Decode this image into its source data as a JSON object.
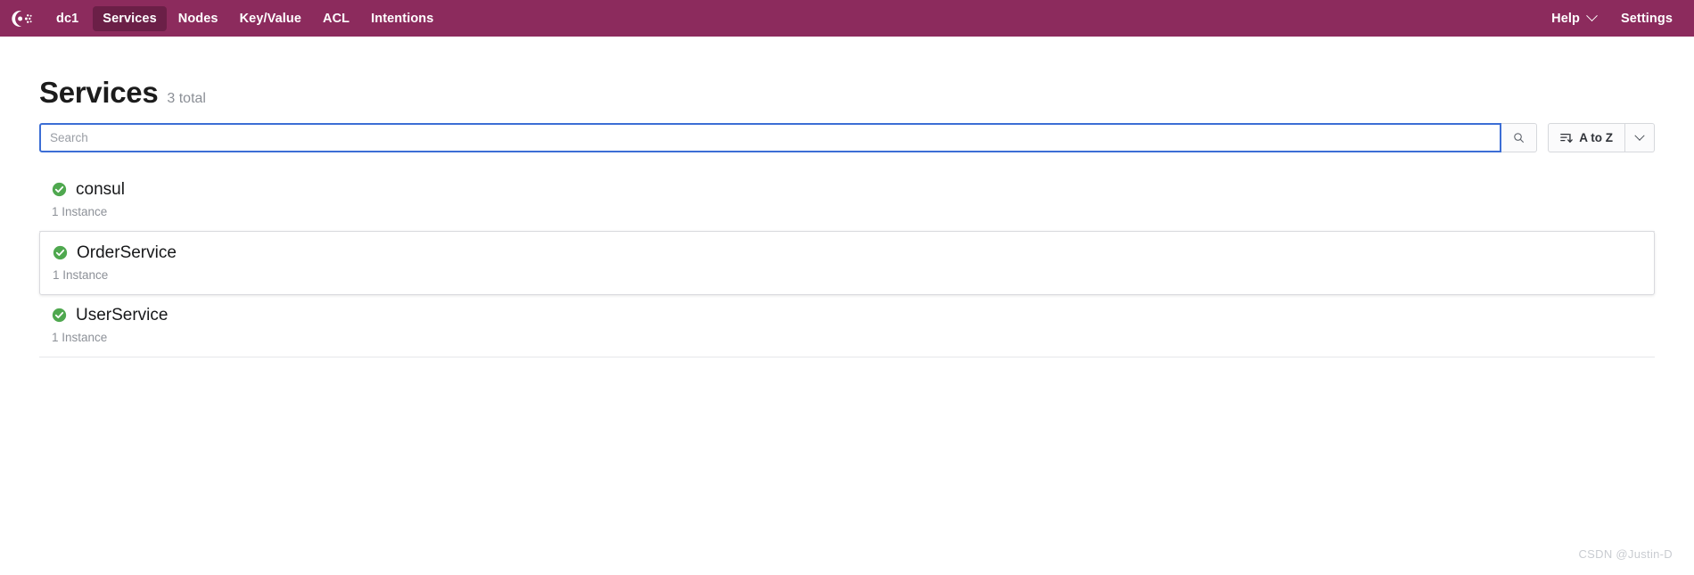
{
  "nav": {
    "logo_icon": "consul-logo-icon",
    "datacenter": "dc1",
    "items": [
      {
        "label": "Services",
        "active": true
      },
      {
        "label": "Nodes",
        "active": false
      },
      {
        "label": "Key/Value",
        "active": false
      },
      {
        "label": "ACL",
        "active": false
      },
      {
        "label": "Intentions",
        "active": false
      }
    ],
    "help_label": "Help",
    "help_icon": "chevron-down-icon",
    "settings_label": "Settings"
  },
  "header": {
    "title": "Services",
    "count_label": "3 total"
  },
  "toolbar": {
    "search_value": "",
    "search_placeholder": "Search",
    "search_icon": "search-icon",
    "sort_label": "A to Z",
    "sort_icon": "sort-descending-icon",
    "sort_caret_icon": "chevron-down-icon"
  },
  "services": [
    {
      "name": "consul",
      "instances": "1 Instance",
      "status": "passing",
      "status_icon": "check-circle-icon",
      "hovered": false
    },
    {
      "name": "OrderService",
      "instances": "1 Instance",
      "status": "passing",
      "status_icon": "check-circle-icon",
      "hovered": true
    },
    {
      "name": "UserService",
      "instances": "1 Instance",
      "status": "passing",
      "status_icon": "check-circle-icon",
      "hovered": false
    }
  ],
  "watermark": "CSDN @Justin-D",
  "colors": {
    "brand": "#8c2b5d",
    "brand_active": "#6b1f47",
    "focus_blue": "#3c6ed5",
    "status_green": "#4fa84f",
    "muted_text": "#8b8f96"
  }
}
